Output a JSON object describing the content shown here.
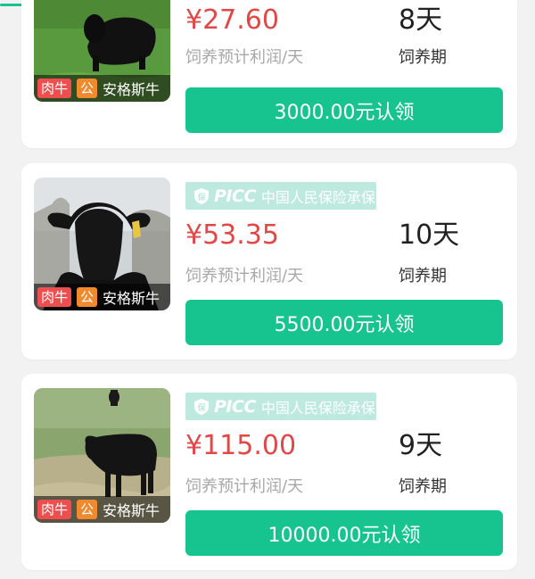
{
  "colors": {
    "accent": "#17c38e",
    "price": "#e04848",
    "tag_type": "#ef4e4e",
    "tag_sex": "#f08a2e",
    "insurance_badge": "#bde9df"
  },
  "insurance": {
    "logo": "PICC",
    "text": "中国人民保险承保"
  },
  "labels": {
    "profit": "饲养预计利润/天",
    "period": "饲养期"
  },
  "cards": [
    {
      "type_tag": "肉牛",
      "sex_tag": "公",
      "breed": "安格斯牛",
      "price": "¥27.60",
      "days": "8天",
      "button": "3000.00元认领",
      "insured": false
    },
    {
      "type_tag": "肉牛",
      "sex_tag": "公",
      "breed": "安格斯牛",
      "price": "¥53.35",
      "days": "10天",
      "button": "5500.00元认领",
      "insured": true
    },
    {
      "type_tag": "肉牛",
      "sex_tag": "公",
      "breed": "安格斯牛",
      "price": "¥115.00",
      "days": "9天",
      "button": "10000.00元认领",
      "insured": true
    }
  ]
}
